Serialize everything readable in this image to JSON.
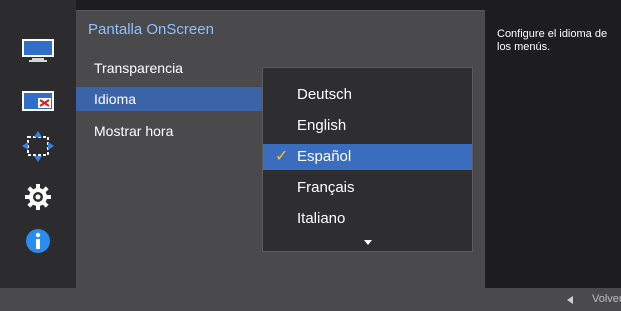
{
  "panel": {
    "title": "Pantalla OnScreen"
  },
  "menu": {
    "items": [
      {
        "label": "Transparencia"
      },
      {
        "label": "Idioma",
        "selected": true
      },
      {
        "label": "Mostrar hora"
      }
    ]
  },
  "dropdown": {
    "options": [
      "Deutsch",
      "English",
      "Español",
      "Français",
      "Italiano"
    ],
    "selected": "Español",
    "check_glyph": "✓",
    "more_indicator": "chevron-down-icon"
  },
  "help": {
    "text": "Configure el idioma de los menús."
  },
  "footer": {
    "back_label": "Volver"
  },
  "sidebar": {
    "icons": [
      "monitor-icon",
      "picture-in-picture-icon",
      "position-size-icon",
      "settings-gear-icon",
      "info-icon"
    ]
  },
  "colors": {
    "title_accent": "#8ec0ff",
    "selection": "#3b6dbf",
    "check": "#f2c230"
  }
}
